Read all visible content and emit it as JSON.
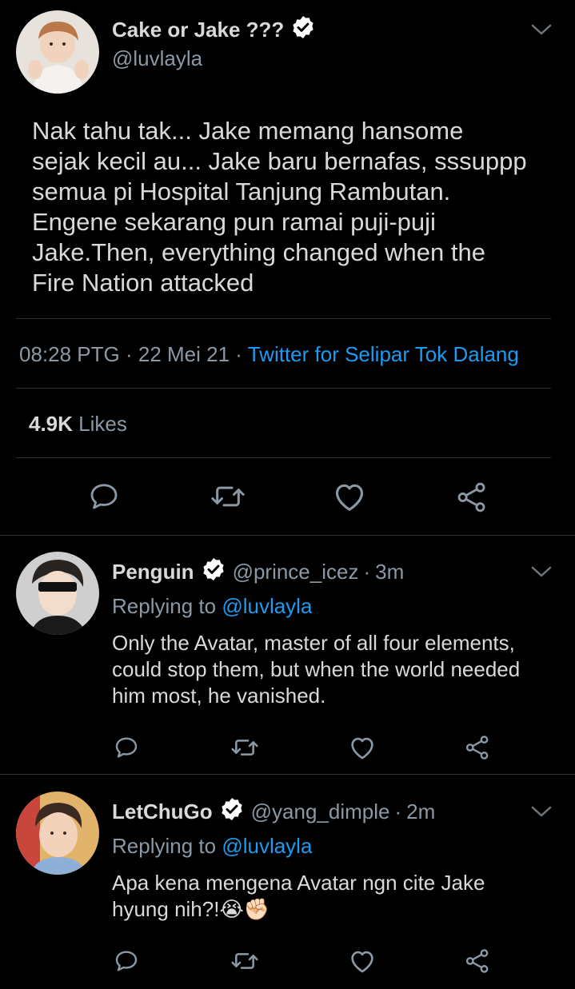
{
  "main_tweet": {
    "display_name": "Cake or Jake ???",
    "handle": "@luvlayla",
    "text_lines": [
      "Nak tahu tak... Jake memang hansome",
      "sejak kecil au... Jake baru bernafas, sssuppp",
      "semua pi Hospital Tanjung Rambutan.",
      "Engene sekarang pun ramai puji-puji",
      "Jake.Then, everything changed when the",
      "Fire Nation attacked"
    ],
    "time": "08:28 PTG",
    "date": "22 Mei 21",
    "separator": "·",
    "source": "Twitter for Selipar Tok Dalang",
    "likes_count": "4.9K",
    "likes_label": "Likes"
  },
  "replies": [
    {
      "display_name": "Penguin",
      "handle": "@prince_icez",
      "time": "3m",
      "replying_label": "Replying to",
      "replying_to": "@luvlayla",
      "text_lines": [
        "Only the Avatar, master of all four elements,",
        "could stop them, but when the world needed",
        "him most, he vanished."
      ]
    },
    {
      "display_name": "LetChuGo",
      "handle": "@yang_dimple",
      "time": "2m",
      "replying_label": "Replying to",
      "replying_to": "@luvlayla",
      "text_lines": [
        "Apa kena mengena Avatar ngn cite Jake",
        "hyung nih?!😭✊🏻"
      ]
    }
  ],
  "icons": {
    "reply": "reply-icon",
    "retweet": "retweet-icon",
    "like": "heart-icon",
    "share": "share-icon",
    "verified": "verified-badge-icon",
    "more": "chevron-down-icon"
  },
  "colors": {
    "background": "#000000",
    "text": "#d9d9d9",
    "muted": "#8b98a5",
    "link": "#1d9bf0",
    "divider": "#2f3336"
  }
}
